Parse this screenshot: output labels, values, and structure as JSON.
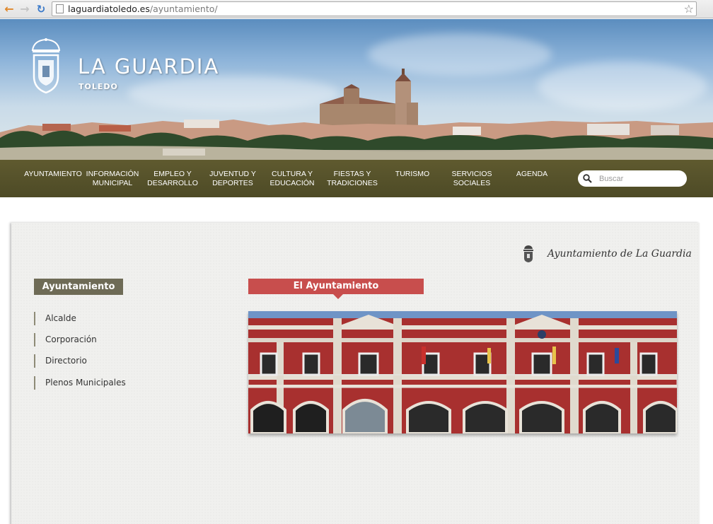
{
  "browser": {
    "url_host": "laguardiatoledo.es",
    "url_path": "/ayuntamiento/"
  },
  "header": {
    "title": "LA GUARDIA",
    "subtitle": "TOLEDO"
  },
  "nav": {
    "items": [
      {
        "line1": "AYUNTAMIENTO",
        "line2": ""
      },
      {
        "line1": "INFORMACIÓN",
        "line2": "MUNICIPAL"
      },
      {
        "line1": "EMPLEO Y",
        "line2": "DESARROLLO"
      },
      {
        "line1": "JUVENTUD Y",
        "line2": "DEPORTES"
      },
      {
        "line1": "CULTURA Y",
        "line2": "EDUCACIÓN"
      },
      {
        "line1": "FIESTAS Y",
        "line2": "TRADICIONES"
      },
      {
        "line1": "TURISMO",
        "line2": ""
      },
      {
        "line1": "SERVICIOS",
        "line2": "SOCIALES"
      },
      {
        "line1": "AGENDA",
        "line2": ""
      }
    ],
    "search_placeholder": "Buscar"
  },
  "content": {
    "ayuntamiento_signature": "Ayuntamiento de La Guardia",
    "sidebar": {
      "title": "Ayuntamiento",
      "links": [
        "Alcalde",
        "Corporación",
        "Directorio",
        "Plenos Municipales"
      ]
    },
    "section_title": "El Ayuntamiento"
  },
  "colors": {
    "nav_bg": "#5a562c",
    "sidebar_title_bg": "#6e6b56",
    "section_title_bg": "#c84e4d",
    "building_red": "#a8302f"
  }
}
